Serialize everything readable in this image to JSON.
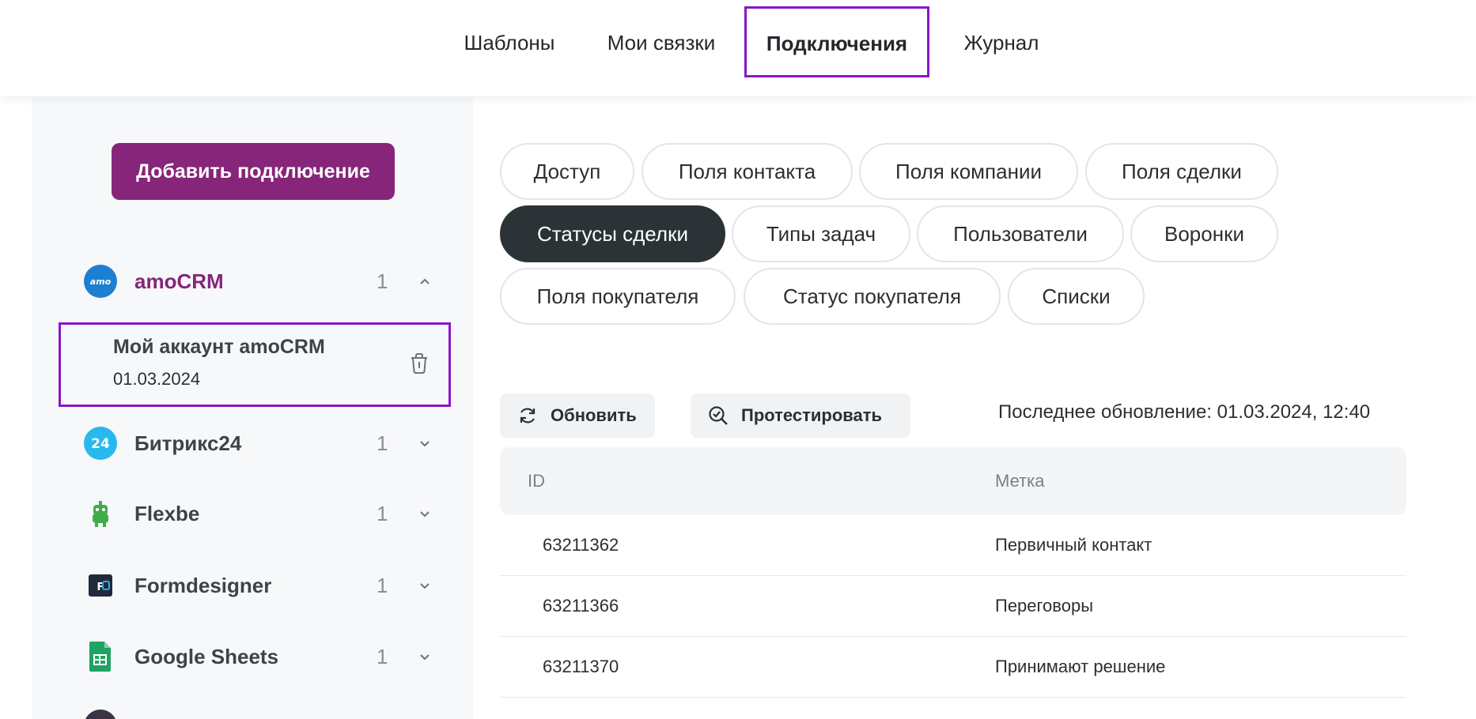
{
  "nav": {
    "tabs": [
      {
        "label": "Шаблоны"
      },
      {
        "label": "Мои связки"
      },
      {
        "label": "Подключения"
      },
      {
        "label": "Журнал"
      }
    ],
    "active_index": 2
  },
  "sidebar": {
    "add_button": "Добавить подключение",
    "integrations": [
      {
        "name": "amoCRM",
        "count": "1",
        "expanded": true,
        "icon": "amocrm-logo-icon"
      },
      {
        "name": "Битрикс24",
        "count": "1",
        "expanded": false,
        "icon": "bitrix24-logo-icon"
      },
      {
        "name": "Flexbe",
        "count": "1",
        "expanded": false,
        "icon": "flexbe-logo-icon"
      },
      {
        "name": "Formdesigner",
        "count": "1",
        "expanded": false,
        "icon": "formdesigner-logo-icon"
      },
      {
        "name": "Google Sheets",
        "count": "1",
        "expanded": false,
        "icon": "google-sheets-logo-icon"
      }
    ],
    "account": {
      "name": "Мой аккаунт amoCRM",
      "date": "01.03.2024"
    }
  },
  "chips": [
    {
      "label": "Доступ"
    },
    {
      "label": "Поля контакта"
    },
    {
      "label": "Поля компании"
    },
    {
      "label": "Поля сделки"
    },
    {
      "label": "Статусы сделки"
    },
    {
      "label": "Типы задач"
    },
    {
      "label": "Пользователи"
    },
    {
      "label": "Воронки"
    },
    {
      "label": "Поля покупателя"
    },
    {
      "label": "Статус покупателя"
    },
    {
      "label": "Списки"
    }
  ],
  "active_chip": "Статусы сделки",
  "actions": {
    "refresh": "Обновить",
    "test": "Протестировать",
    "last_update": "Последнее обновление: 01.03.2024, 12:40"
  },
  "table": {
    "headers": [
      "ID",
      "Метка"
    ],
    "rows": [
      [
        "63211362",
        "Первичный контакт"
      ],
      [
        "63211366",
        "Переговоры"
      ],
      [
        "63211370",
        "Принимают решение"
      ]
    ]
  },
  "colors": {
    "brand": "#86257a",
    "focus_outline": "#8a16c8",
    "active_chip": "#2b3336"
  }
}
